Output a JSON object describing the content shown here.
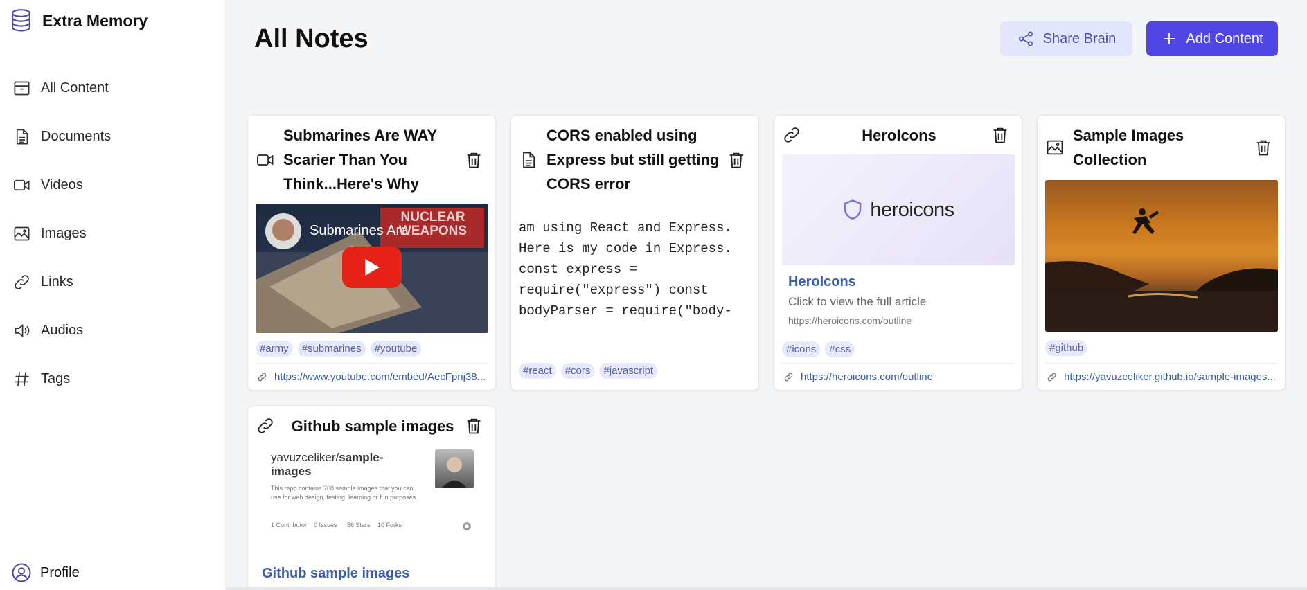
{
  "app": {
    "title": "Extra Memory"
  },
  "sidebar": {
    "items": [
      {
        "label": "All Content",
        "icon": "archive-icon"
      },
      {
        "label": "Documents",
        "icon": "document-icon"
      },
      {
        "label": "Videos",
        "icon": "video-camera-icon"
      },
      {
        "label": "Images",
        "icon": "image-icon"
      },
      {
        "label": "Links",
        "icon": "link-icon"
      },
      {
        "label": "Audios",
        "icon": "speaker-icon"
      },
      {
        "label": "Tags",
        "icon": "hashtag-icon"
      }
    ],
    "profile_label": "Profile"
  },
  "header": {
    "title": "All Notes",
    "share_label": "Share Brain",
    "add_label": "Add Content"
  },
  "colors": {
    "accent": "#4f46e5",
    "share_bg": "#e2e5fb",
    "tag_bg": "#e6e8fb",
    "link": "#3a5a9a"
  },
  "cards": [
    {
      "type": "video",
      "title": "Submarines Are WAY Scarier Than You Think...Here's Why",
      "thumb_caption": "Submarines Are ...",
      "thumb_banner": "NUCLEAR WEAPONS",
      "tags": [
        "#army",
        "#submarines",
        "#youtube"
      ],
      "link": "https://www.youtube.com/embed/AecFpnj38..."
    },
    {
      "type": "document",
      "title": "CORS enabled using Express but still getting CORS error",
      "body": "am using React and Express. Here is my code in Express. const express = require(\"express\") const bodyParser = require(\"body-parser\") const { connection }…",
      "tags": [
        "#react",
        "#cors",
        "#javascript"
      ]
    },
    {
      "type": "link",
      "title": "HeroIcons",
      "preview_brand": "heroicons",
      "preview_title": "HeroIcons",
      "preview_desc": "Click to view the full article",
      "preview_url": "https://heroicons.com/outline",
      "tags": [
        "#icons",
        "#css"
      ],
      "link": "https://heroicons.com/outline"
    },
    {
      "type": "image",
      "title": "Sample Images Collection",
      "tags": [
        "#github"
      ],
      "link": "https://yavuzceliker.github.io/sample-images..."
    },
    {
      "type": "link",
      "title": "Github sample images",
      "preview_repo_owner": "yavuzceliker/",
      "preview_repo_name": "sample-images",
      "preview_desc": "This repo contains 700 sample images that you can use for web design, testing, learning or fun purposes.",
      "preview_stats": [
        {
          "num": "1",
          "label": "Contributor"
        },
        {
          "num": "0",
          "label": "Issues"
        },
        {
          "num": "56",
          "label": "Stars"
        },
        {
          "num": "10",
          "label": "Forks"
        }
      ],
      "preview_title": "Github sample images"
    }
  ]
}
